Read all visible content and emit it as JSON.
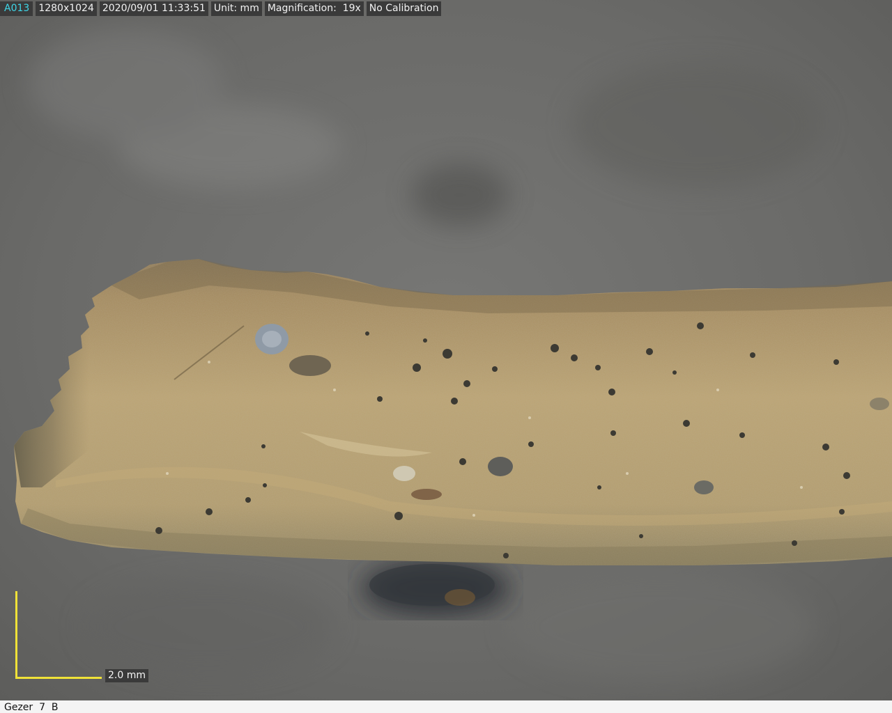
{
  "info_bar": {
    "image_id": "A013",
    "resolution": "1280x1024",
    "datetime": "2020/09/01 11:33:51",
    "unit": "Unit: mm",
    "magnification": "Magnification:  19x",
    "calibration": "No Calibration"
  },
  "scale_bar": {
    "label": "2.0 mm",
    "color": "#f0e238"
  },
  "caption": {
    "text": "Gezer  7  B"
  },
  "colors": {
    "background": "#6d6d6b",
    "specimen": "#b49a6a",
    "label_background": "#3a3a3a",
    "id_text": "#3fd7e8"
  }
}
